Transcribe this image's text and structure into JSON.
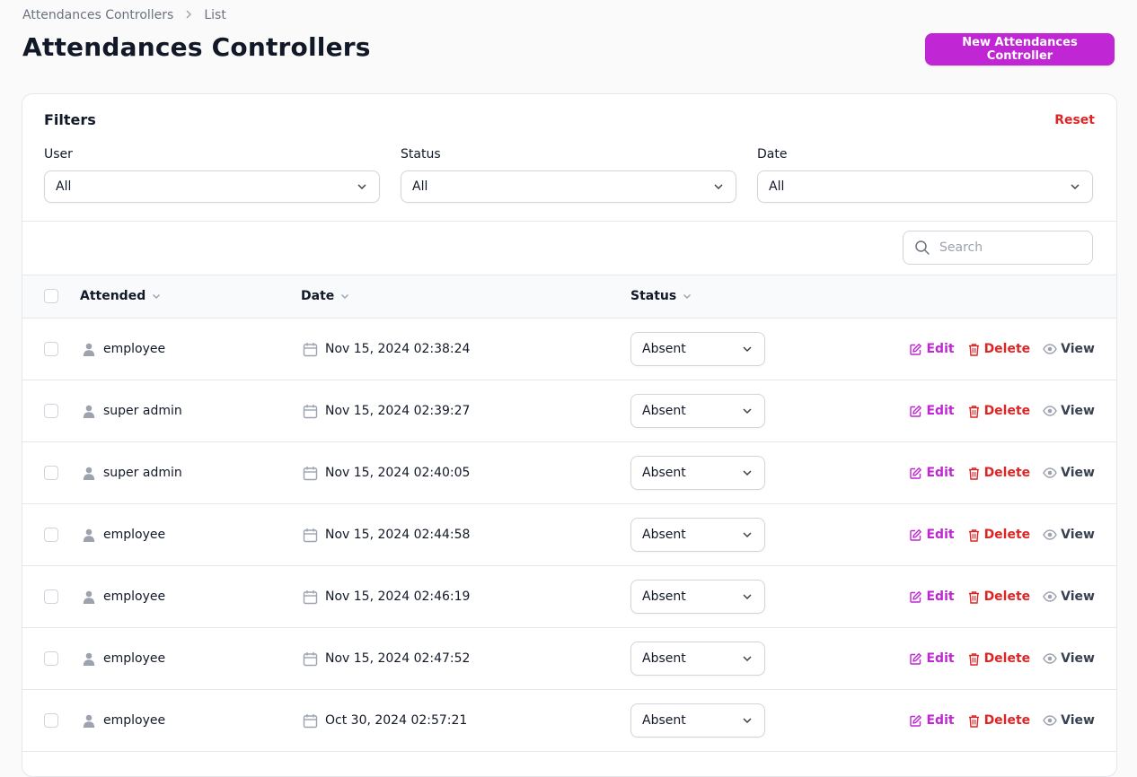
{
  "breadcrumb": {
    "parent": "Attendances Controllers",
    "current": "List"
  },
  "page": {
    "title": "Attendances Controllers",
    "new_button": "New Attendances Controller"
  },
  "filters": {
    "title": "Filters",
    "reset": "Reset",
    "user": {
      "label": "User",
      "value": "All"
    },
    "status": {
      "label": "Status",
      "value": "All"
    },
    "date": {
      "label": "Date",
      "value": "All"
    }
  },
  "search": {
    "placeholder": "Search"
  },
  "table": {
    "columns": {
      "attended": "Attended",
      "date": "Date",
      "status": "Status"
    },
    "actions": {
      "edit": "Edit",
      "delete": "Delete",
      "view": "View"
    },
    "rows": [
      {
        "user": "employee",
        "date": "Nov 15, 2024 02:38:24",
        "status": "Absent"
      },
      {
        "user": "super admin",
        "date": "Nov 15, 2024 02:39:27",
        "status": "Absent"
      },
      {
        "user": "super admin",
        "date": "Nov 15, 2024 02:40:05",
        "status": "Absent"
      },
      {
        "user": "employee",
        "date": "Nov 15, 2024 02:44:58",
        "status": "Absent"
      },
      {
        "user": "employee",
        "date": "Nov 15, 2024 02:46:19",
        "status": "Absent"
      },
      {
        "user": "employee",
        "date": "Nov 15, 2024 02:47:52",
        "status": "Absent"
      },
      {
        "user": "employee",
        "date": "Oct 30, 2024 02:57:21",
        "status": "Absent"
      }
    ]
  },
  "colors": {
    "primary": "#c026d3",
    "danger": "#dc2626",
    "muted": "#9ca3af"
  },
  "icons": [
    "chevron-right-icon",
    "chevron-down-icon",
    "search-icon",
    "user-icon",
    "calendar-icon",
    "edit-icon",
    "trash-icon",
    "eye-icon"
  ]
}
